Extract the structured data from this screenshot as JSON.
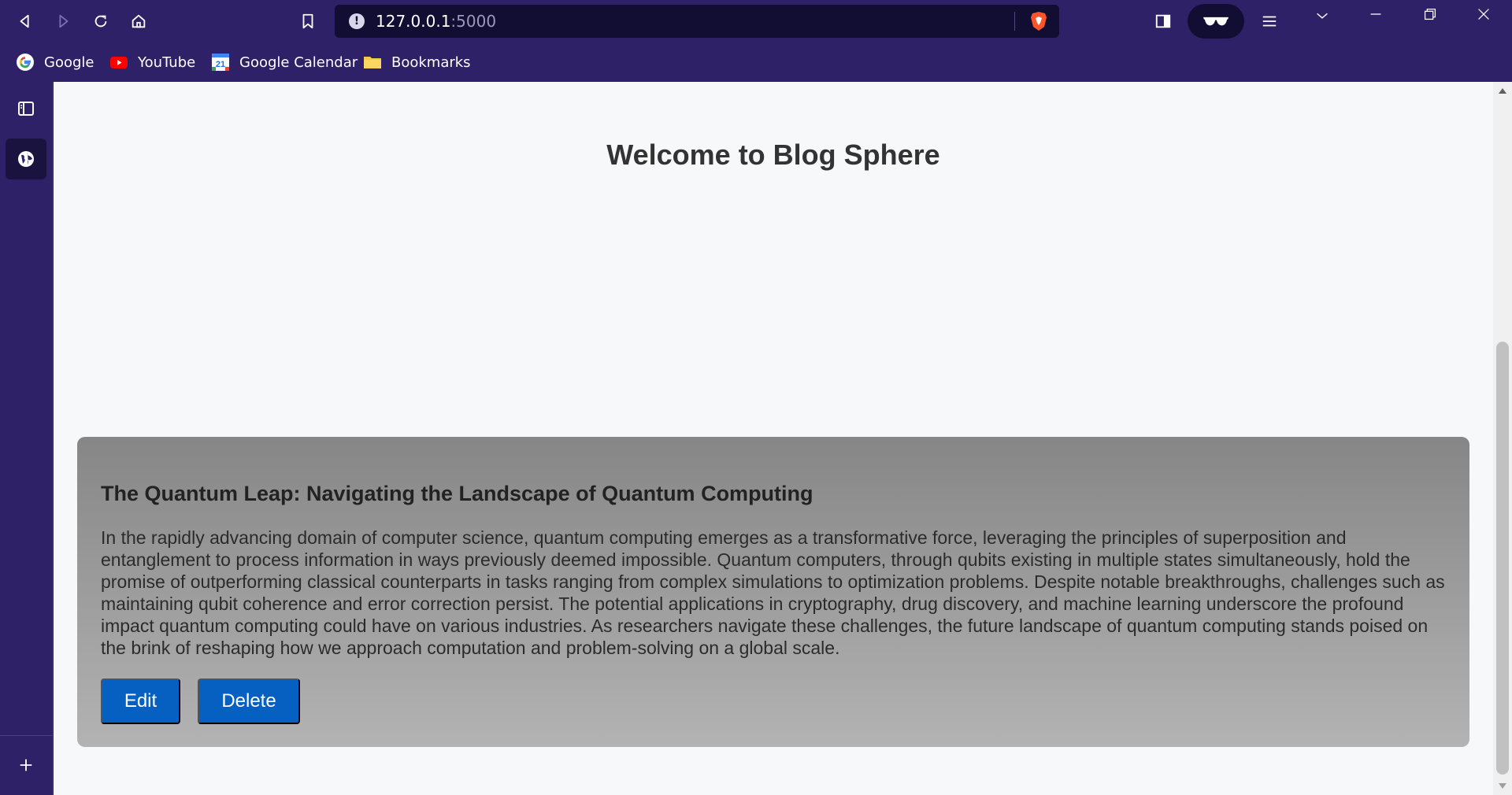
{
  "browser": {
    "url_host": "127.0.0.1",
    "url_port": ":5000",
    "bookmarks": [
      {
        "label": "Google",
        "icon": "google-icon"
      },
      {
        "label": "YouTube",
        "icon": "youtube-icon"
      },
      {
        "label": "Google Calendar",
        "icon": "calendar-icon",
        "badge": "21"
      },
      {
        "label": "Bookmarks",
        "icon": "folder-icon"
      }
    ]
  },
  "page": {
    "title": "Welcome to Blog Sphere"
  },
  "post": {
    "title": "The Quantum Leap: Navigating the Landscape of Quantum Computing",
    "body": "In the rapidly advancing domain of computer science, quantum computing emerges as a transformative force, leveraging the principles of superposition and entanglement to process information in ways previously deemed impossible. Quantum computers, through qubits existing in multiple states simultaneously, hold the promise of outperforming classical counterparts in tasks ranging from complex simulations to optimization problems. Despite notable breakthroughs, challenges such as maintaining qubit coherence and error correction persist. The potential applications in cryptography, drug discovery, and machine learning underscore the profound impact quantum computing could have on various industries. As researchers navigate these challenges, the future landscape of quantum computing stands poised on the brink of reshaping how we approach computation and problem-solving on a global scale.",
    "edit_label": "Edit",
    "delete_label": "Delete"
  },
  "colors": {
    "browser_chrome": "#2f2167",
    "button_primary": "#0560c1"
  }
}
